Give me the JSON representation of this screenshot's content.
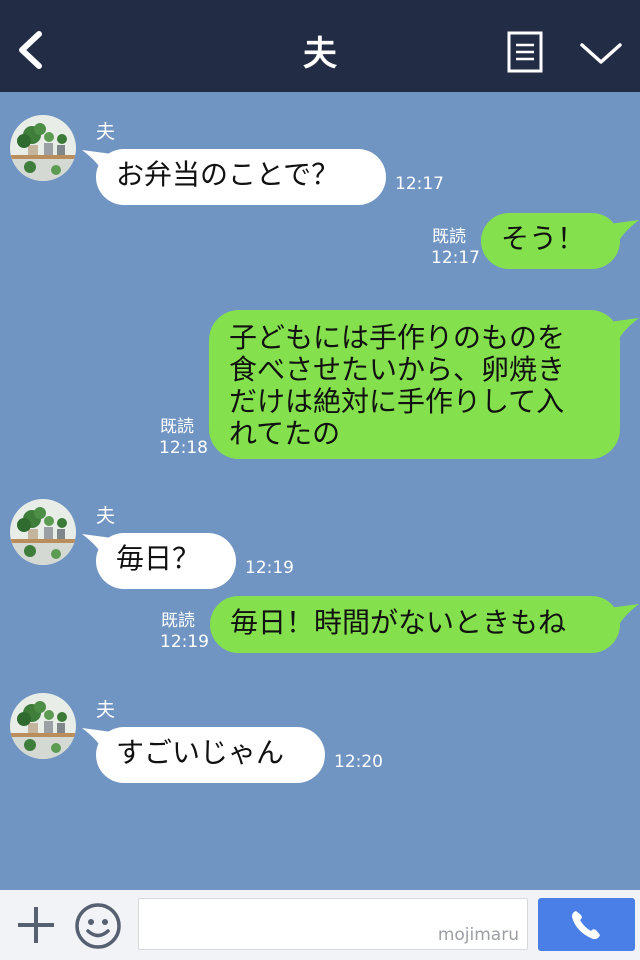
{
  "header": {
    "title": "夫",
    "back_icon": "chevron-left-icon",
    "menu_icon": "list-icon",
    "collapse_icon": "chevron-down-icon",
    "background": "#232c45"
  },
  "chat": {
    "background": "#7195c2",
    "messages": [
      {
        "direction": "in",
        "sender": "夫",
        "text": "お弁当のことで？",
        "time": "12:17"
      },
      {
        "direction": "out",
        "read": "既読",
        "text": "そう！",
        "time": "12:17"
      },
      {
        "direction": "out",
        "read": "既読",
        "lines": [
          "子どもには手作りのものを",
          "食べさせたいから、卵焼き",
          "だけは絶対に手作りして入",
          "れてたの"
        ],
        "time": "12:18"
      },
      {
        "direction": "in",
        "sender": "夫",
        "text": "毎日？",
        "time": "12:19"
      },
      {
        "direction": "out",
        "read": "既読",
        "text": "毎日！時間がないときもね",
        "time": "12:19"
      },
      {
        "direction": "in",
        "sender": "夫",
        "text": "すごいじゃん",
        "time": "12:20"
      }
    ]
  },
  "footer": {
    "plus_icon": "plus-icon",
    "emoji_icon": "emoji-icon",
    "input_value": "",
    "watermark": "mojimaru",
    "call_icon": "phone-icon",
    "call_color": "#4a7fe8"
  },
  "colors": {
    "incoming_bubble": "#ffffff",
    "outgoing_bubble": "#84e04c"
  }
}
